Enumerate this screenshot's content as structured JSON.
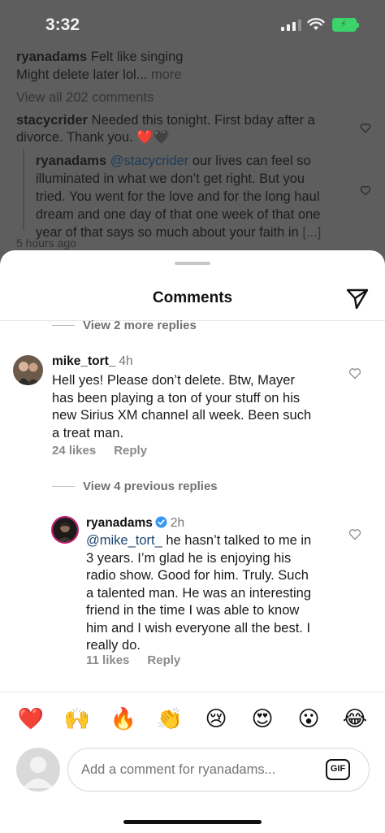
{
  "status_bar": {
    "time": "3:32"
  },
  "background": {
    "post_user": "ryanadams",
    "post_caption": "Felt like singing",
    "post_caption_2": "Might delete later lol...",
    "post_more": "more",
    "view_all": "View all 202 comments",
    "comment_user": "stacycrider",
    "comment_text_1": "Needed this tonight. First bday after a",
    "comment_text_2": "divorce. Thank you. ❤️🖤",
    "reply_user": "ryanadams",
    "reply_mention": "@stacycrider",
    "reply_line_1": "our lives can feel so",
    "reply_line_2": "illuminated in what we don’t get right. But you",
    "reply_line_3": "tried. You went for the love and for the long haul",
    "reply_line_4": "dream and one day of that one week of that one",
    "reply_line_5": "year of that says so much about your faith in",
    "reply_ellipsis": "[...]",
    "timestamp": "5 hours ago"
  },
  "sheet": {
    "title": "Comments",
    "view_more_replies": "View 2 more replies",
    "view_previous_replies": "View 4 previous replies",
    "comments": [
      {
        "user": "mike_tort_",
        "age": "4h",
        "lines": [
          "Hell yes! Please don’t delete. Btw, Mayer",
          "has been playing a ton of your stuff on his",
          "new Sirius XM channel all week. Been such",
          "a treat man."
        ],
        "likes": "24 likes",
        "reply": "Reply"
      },
      {
        "user": "ryanadams",
        "age": "2h",
        "mention": "@mike_tort_",
        "lines": [
          "he hasn’t talked to me in",
          "3 years. I’m glad he is enjoying his",
          "radio show. Good for him. Truly. Such",
          "a talented man. He was an interesting",
          "friend in the time I was able to know",
          "him and I wish everyone all the best. I",
          "really do."
        ],
        "likes": "11 likes",
        "reply": "Reply"
      }
    ],
    "emojis": [
      "❤️",
      "🙌",
      "🔥",
      "👏",
      "😢",
      "😍",
      "😮",
      "😂"
    ],
    "input_placeholder": "Add a comment for ryanadams...",
    "gif_label": "GIF"
  },
  "colors": {
    "accent_link": "#1d4470",
    "verified": "#3897f0"
  }
}
